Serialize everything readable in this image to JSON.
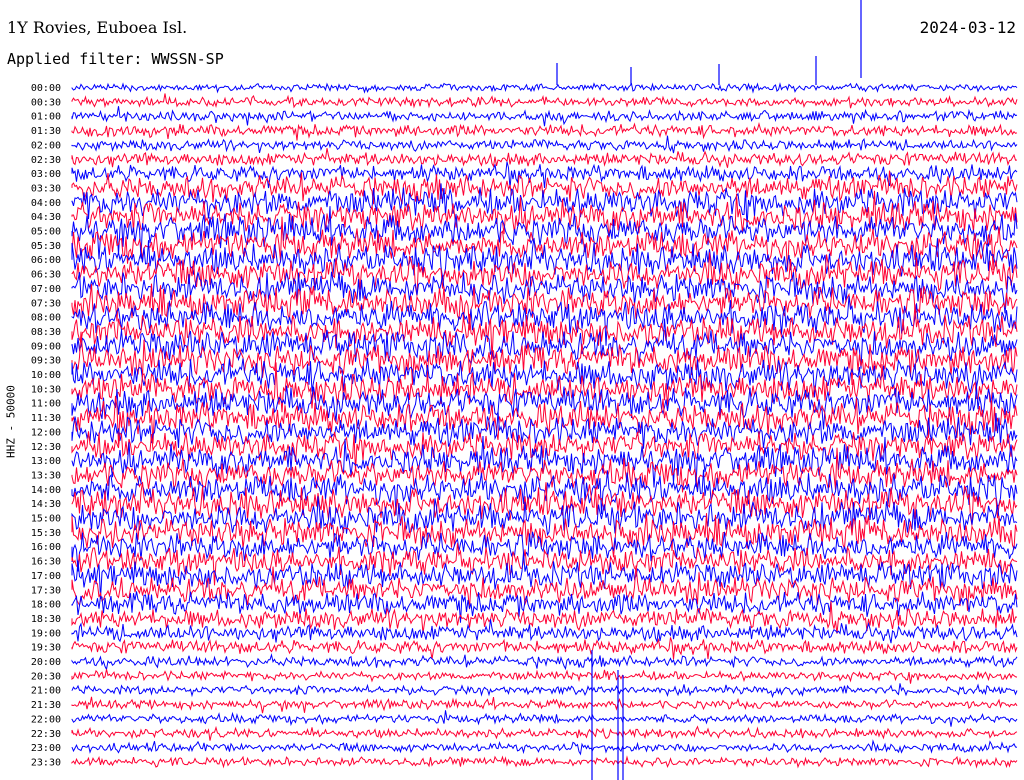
{
  "header": {
    "station": "1Y Rovies, Euboea Isl.",
    "date": "2024-03-12",
    "filter": "Applied filter: WWSSN-SP"
  },
  "channel_label": "HHZ - 50000",
  "colors": {
    "trace_a": "#0000ff",
    "trace_b": "#ff0033",
    "background": "#ffffff"
  },
  "chart_data": {
    "type": "line",
    "title": "1Y Rovies, Euboea Isl.",
    "ylabel": "HHZ - 50000",
    "y_categories": [
      "00:00",
      "00:30",
      "01:00",
      "01:30",
      "02:00",
      "02:30",
      "03:00",
      "03:30",
      "04:00",
      "04:30",
      "05:00",
      "05:30",
      "06:00",
      "06:30",
      "07:00",
      "07:30",
      "08:00",
      "08:30",
      "09:00",
      "09:30",
      "10:00",
      "10:30",
      "11:00",
      "11:30",
      "12:00",
      "12:30",
      "13:00",
      "13:30",
      "14:00",
      "14:30",
      "15:00",
      "15:30",
      "16:00",
      "16:30",
      "17:00",
      "17:30",
      "18:00",
      "18:30",
      "19:00",
      "19:30",
      "20:00",
      "20:30",
      "21:00",
      "21:30",
      "22:00",
      "22:30",
      "23:00",
      "23:30"
    ],
    "x_range_minutes": [
      0,
      30
    ],
    "relative_amplitude": [
      0.25,
      0.3,
      0.35,
      0.4,
      0.35,
      0.45,
      0.55,
      0.8,
      0.95,
      1.0,
      1.0,
      1.0,
      1.0,
      1.0,
      1.0,
      1.0,
      1.0,
      1.0,
      1.0,
      1.0,
      1.0,
      1.0,
      1.0,
      1.0,
      0.95,
      0.95,
      0.95,
      0.95,
      1.0,
      1.0,
      1.0,
      1.0,
      0.9,
      0.85,
      0.85,
      0.85,
      0.75,
      0.65,
      0.55,
      0.45,
      0.35,
      0.3,
      0.3,
      0.3,
      0.3,
      0.3,
      0.3,
      0.3
    ],
    "series_colors": [
      "#0000ff",
      "#ff0033"
    ],
    "grid": false
  }
}
